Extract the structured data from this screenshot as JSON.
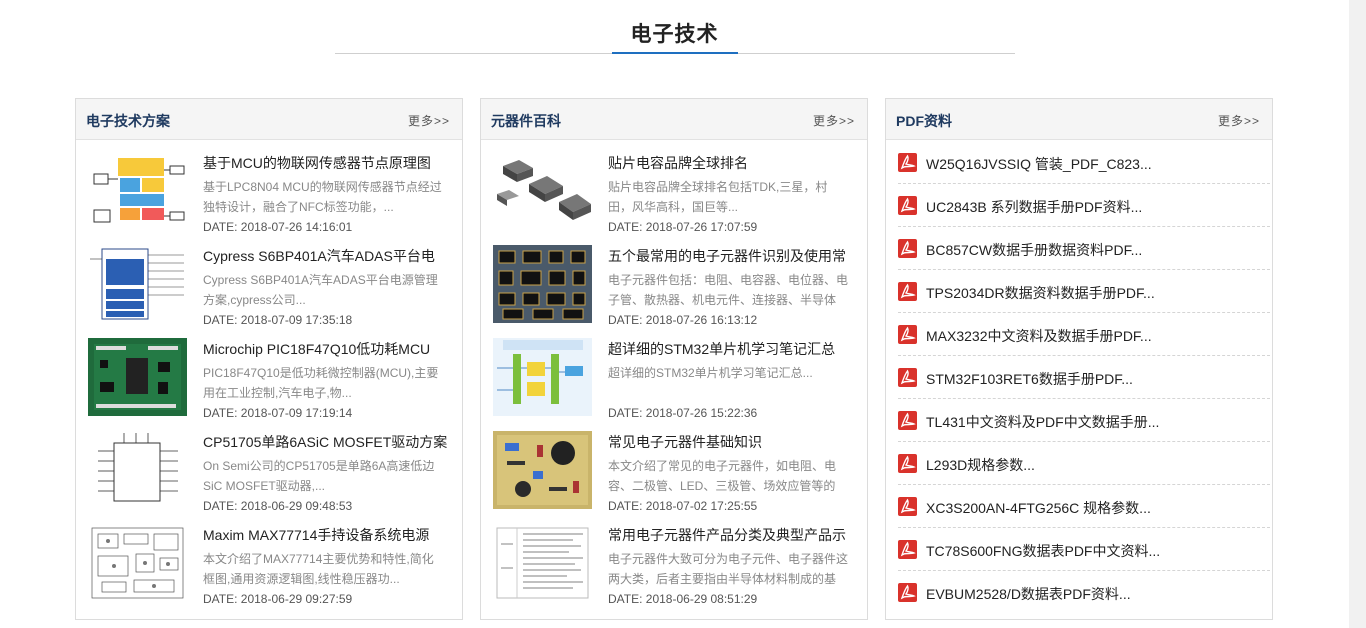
{
  "section": {
    "title": "电子技术"
  },
  "panels": [
    {
      "title": "电子技术方案",
      "more": "更多>>",
      "articles": [
        {
          "title": "基于MCU的物联网传感器节点原理图",
          "desc": "基于LPC8N04 MCU的物联网传感器节点经过独特设计，融合了NFC标签功能，...",
          "date": "DATE: 2018-07-26 14:16:01",
          "thumb": "block-diagram"
        },
        {
          "title": "Cypress S6BP401A汽车ADAS平台电",
          "desc": "Cypress S6BP401A汽车ADAS平台电源管理方案,cypress公司...",
          "date": "DATE: 2018-07-09 17:35:18",
          "thumb": "power-diagram"
        },
        {
          "title": "Microchip PIC18F47Q10低功耗MCU",
          "desc": "PIC18F47Q10是低功耗微控制器(MCU),主要用在工业控制,汽车电子,物...",
          "date": "DATE: 2018-07-09 17:19:14",
          "thumb": "green-board"
        },
        {
          "title": "CP51705单路6ASiC MOSFET驱动方案",
          "desc": "On Semi公司的CP51705是单路6A高速低边SiC MOSFET驱动器,...",
          "date": "DATE: 2018-06-29 09:48:53",
          "thumb": "ic-pinout"
        },
        {
          "title": "Maxim MAX77714手持设备系统电源",
          "desc": "本文介绍了MAX77714主要优势和特性,简化框图,通用资源逻辑图,线性稳压器功...",
          "date": "DATE: 2018-06-29 09:27:59",
          "thumb": "pcb-layout"
        }
      ]
    },
    {
      "title": "元器件百科",
      "more": "更多>>",
      "articles": [
        {
          "title": "贴片电容品牌全球排名",
          "desc": "贴片电容品牌全球排名包括TDK,三星，村田，风华高科，国巨等...",
          "date": "DATE: 2018-07-26 17:07:59",
          "thumb": "smd-capacitors"
        },
        {
          "title": "五个最常用的电子元器件识别及使用常",
          "desc": "电子元器件包括：电阻、电容器、电位器、电子管、散热器、机电元件、连接器、半导体",
          "date": "DATE: 2018-07-26 16:13:12",
          "thumb": "component-grid"
        },
        {
          "title": "超详细的STM32单片机学习笔记汇总",
          "desc": "超详细的STM32单片机学习笔记汇总...",
          "date": "DATE: 2018-07-26 15:22:36",
          "thumb": "stm32-gpio"
        },
        {
          "title": "常见电子元器件基础知识",
          "desc": "本文介绍了常见的电子元器件，如电阻、电容、二极管、LED、三极管、场效应管等的",
          "date": "DATE: 2018-07-02 17:25:55",
          "thumb": "yellow-board"
        },
        {
          "title": "常用电子元器件产品分类及典型产品示",
          "desc": "电子元器件大致可分为电子元件、电子器件这两大类，后者主要指由半导体材料制成的基",
          "date": "DATE: 2018-06-29 08:51:29",
          "thumb": "category-table"
        }
      ]
    },
    {
      "title": "PDF资料",
      "more": "更多>>",
      "icon": "pdf-icon",
      "files": [
        "W25Q16JVSSIQ 管装_PDF_C823...",
        "UC2843B 系列数据手册PDF资料...",
        "BC857CW数据手册数据资料PDF...",
        "TPS2034DR数据资料数据手册PDF...",
        "MAX3232中文资料及数据手册PDF...",
        "STM32F103RET6数据手册PDF...",
        "TL431中文资料及PDF中文数据手册...",
        "L293D规格参数...",
        "XC3S200AN-4FTG256C 规格参数...",
        "TC78S600FNG数据表PDF中文资料...",
        "EVBUM2528/D数据表PDF资料..."
      ]
    }
  ],
  "colors": {
    "accent": "#1e6fc0",
    "panel_title": "#1f3a60",
    "pdf_red": "#d9322b"
  }
}
